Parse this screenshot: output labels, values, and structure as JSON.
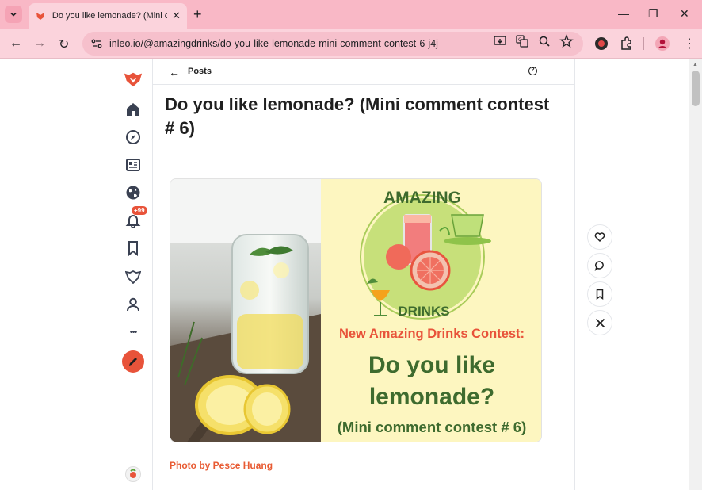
{
  "browser": {
    "tab_title": "Do you like lemonade? (Mini co",
    "close_glyph": "✕",
    "new_tab_glyph": "+",
    "url": "inleo.io/@amazingdrinks/do-you-like-lemonade-mini-comment-contest-6-j4j",
    "nav": {
      "back": "←",
      "forward": "→",
      "reload": "↻"
    },
    "window": {
      "minimize": "—",
      "restore": "❐",
      "close": "✕"
    },
    "menu_glyph": "⋮"
  },
  "sidebar": {
    "notification_badge": "+99",
    "more_glyph": "•••"
  },
  "header": {
    "back_glyph": "←",
    "posts_label": "Posts",
    "help_glyph": "?"
  },
  "post": {
    "title": "Do you like lemonade? (Mini comment contest # 6)",
    "image": {
      "brand_top": "AMAZING",
      "brand_bottom": "DRINKS",
      "contest_heading": "New Amazing Drinks Contest:",
      "question_line1": "Do you like",
      "question_line2": "lemonade?",
      "subtitle": "(Mini comment contest # 6)"
    },
    "caption": "Photo by Pesce Huang"
  },
  "colors": {
    "accent": "#e8533a",
    "tab_strip": "#f9b8c6",
    "toolbar": "#fbd3dc",
    "poster_bg": "#fdf6c0",
    "poster_green": "#3e6b2e"
  },
  "icons": [
    "leo-logo-icon",
    "home-icon",
    "compass-icon",
    "news-icon",
    "globe-icon",
    "bell-icon",
    "bookmark-icon",
    "leo-threads-icon",
    "user-icon",
    "more-icon",
    "pencil-icon",
    "heart-icon",
    "comment-icon",
    "bookmark-icon",
    "x-share-icon"
  ]
}
